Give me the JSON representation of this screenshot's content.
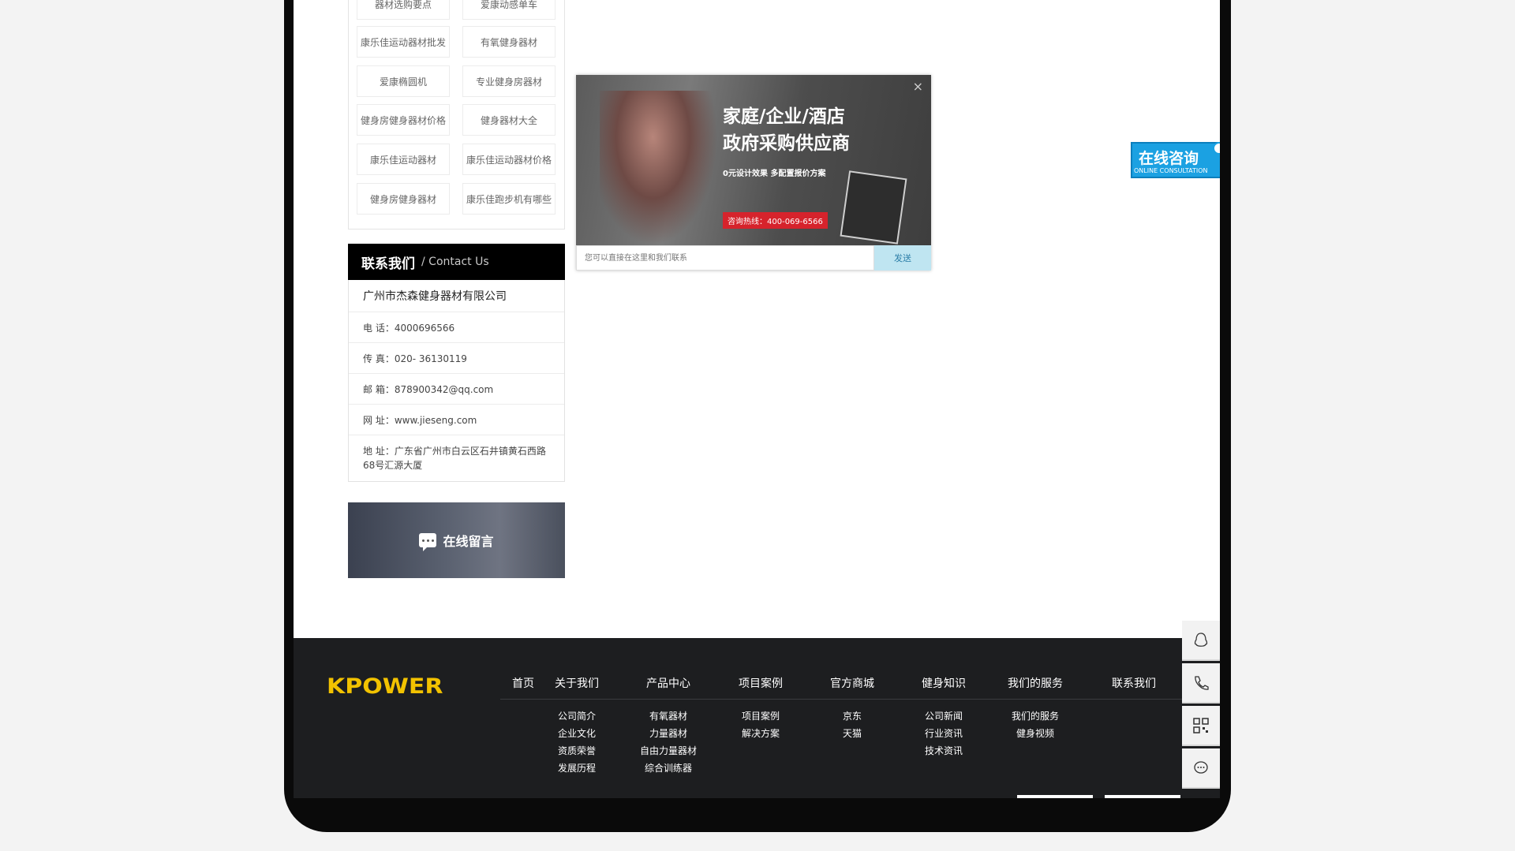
{
  "tags": [
    "器材选购要点",
    "爱康动感单车",
    "康乐佳运动器材批发",
    "有氧健身器材",
    "爱康椭圆机",
    "专业健身房器材",
    "健身房健身器材价格",
    "健身器材大全",
    "康乐佳运动器材",
    "康乐佳运动器材价格",
    "健身房健身器材",
    "康乐佳跑步机有哪些"
  ],
  "contact": {
    "title_zh": "联系我们",
    "title_en": "/ Contact Us",
    "company": "广州市杰森健身器材有限公司",
    "rows": [
      "电 话：4000696566",
      "传 真：020- 36130119",
      "邮 箱：878900342@qq.com",
      "网 址：www.jieseng.com",
      "地 址：广东省广州市白云区石井镇黄石西路68号汇源大厦"
    ]
  },
  "message_banner": {
    "label": "在线留言"
  },
  "popup": {
    "title_line1": "家庭/企业/酒店",
    "title_line2": "政府采购供应商",
    "subtitle": "0元设计效果 多配置报价方案",
    "hotline": "咨询热线：400-069-6566",
    "close": "×",
    "input_placeholder": "您可以直接在这里和我们联系",
    "send_label": "发送"
  },
  "online_consult": {
    "zh": "在线咨询",
    "en": "ONLINE CONSULTATION"
  },
  "footer": {
    "logo": "KPOWER",
    "columns": [
      {
        "title": "首页",
        "items": []
      },
      {
        "title": "关于我们",
        "items": [
          "公司简介",
          "企业文化",
          "资质荣誉",
          "发展历程"
        ]
      },
      {
        "title": "产品中心",
        "items": [
          "有氧器材",
          "力量器材",
          "自由力量器材",
          "综合训练器"
        ]
      },
      {
        "title": "项目案例",
        "items": [
          "项目案例",
          "解决方案"
        ]
      },
      {
        "title": "官方商城",
        "items": [
          "京东",
          "天猫"
        ]
      },
      {
        "title": "健身知识",
        "items": [
          "公司新闻",
          "行业资讯",
          "技术资讯"
        ]
      },
      {
        "title": "我们的服务",
        "items": [
          "我们的服务",
          "健身视频"
        ]
      },
      {
        "title": "联系我们",
        "items": []
      }
    ]
  },
  "dock": [
    "qq-icon",
    "phone-icon",
    "qr-code-icon",
    "chat-icon"
  ],
  "colors": {
    "logo": "#f2c200",
    "footer_bg": "#1d1e20",
    "online_blue": "#1ba1e2",
    "hotline_red": "#d6232c"
  }
}
